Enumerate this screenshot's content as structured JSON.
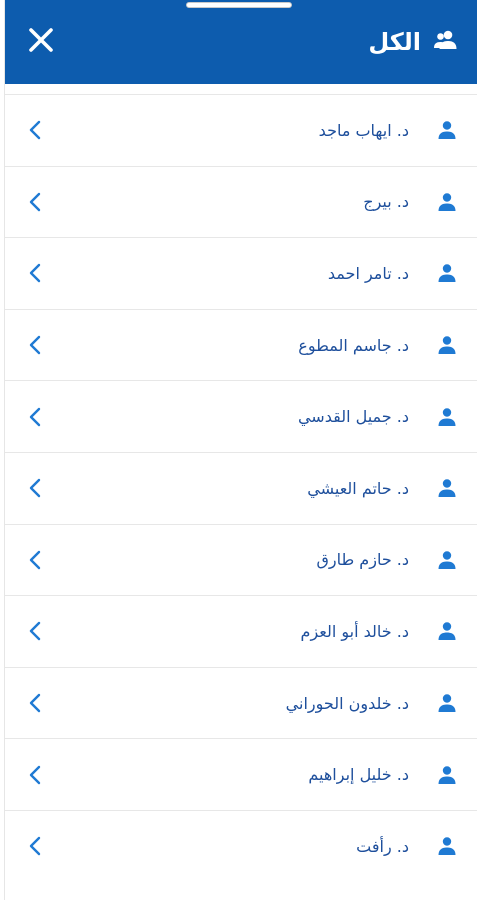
{
  "header": {
    "title": "الكل",
    "group_icon": "people-icon",
    "close_icon": "close-icon"
  },
  "colors": {
    "header_bg": "#0d5cae",
    "accent": "#1f7ad3",
    "text": "#1e4f9c"
  },
  "list": {
    "items": [
      {
        "label": "د. ايهاب ماجد"
      },
      {
        "label": "د. بيرج"
      },
      {
        "label": "د. تامر احمد"
      },
      {
        "label": "د. جاسم المطوع"
      },
      {
        "label": "د. جميل القدسي"
      },
      {
        "label": "د. حاتم العيشي"
      },
      {
        "label": "د. حازم طارق"
      },
      {
        "label": "د. خالد أبو العزم"
      },
      {
        "label": "د. خلدون الحوراني"
      },
      {
        "label": "د. خليل إبراهيم"
      },
      {
        "label": "د. رأفت"
      }
    ]
  }
}
